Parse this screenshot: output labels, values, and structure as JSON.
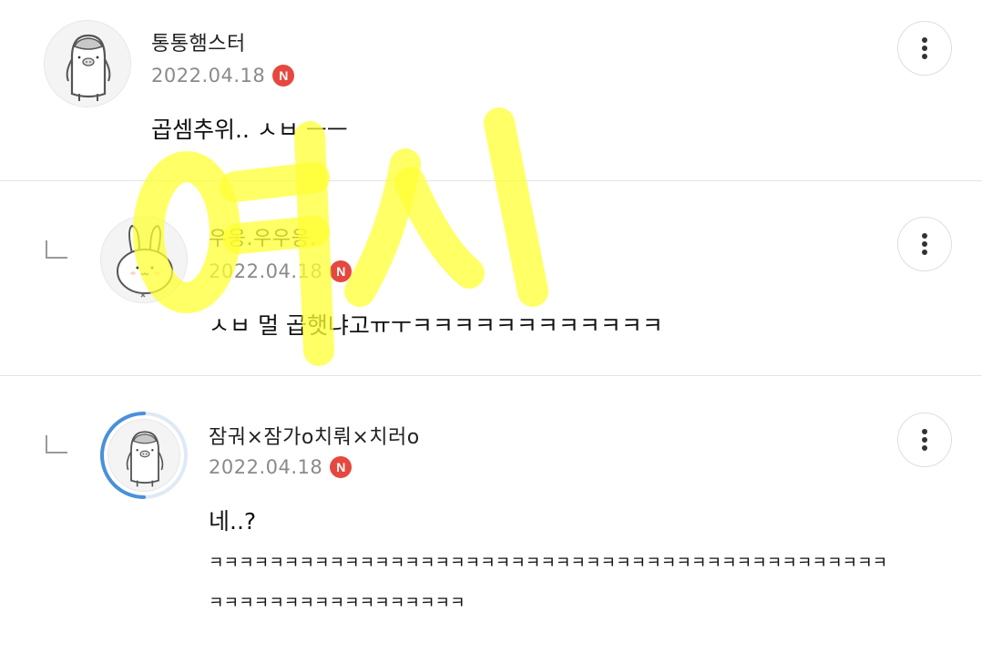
{
  "comments": [
    {
      "nickname": "통통햄스터",
      "date": "2022.04.18",
      "badge": "N",
      "text": "곱셈추위.. ㅅㅂ ㅡㅡ",
      "avatar_icon": "penguin-icon"
    },
    {
      "nickname": "우웅.우우웅.",
      "date": "2022.04.18",
      "badge": "N",
      "text": "ㅅㅂ 멀 곱햇냐고ㅠㅜㅋㅋㅋㅋㅋㅋㅋㅋㅋㅋㅋㅋ",
      "avatar_icon": "bunny-icon"
    },
    {
      "nickname": "잠궈×잠가o치뤄×치러o",
      "date": "2022.04.18",
      "badge": "N",
      "text_lines": [
        "네..?",
        "ㅋㅋㅋㅋㅋㅋㅋㅋㅋㅋㅋㅋㅋㅋㅋㅋㅋㅋㅋㅋㅋㅋㅋㅋㅋㅋㅋㅋㅋㅋㅋㅋㅋㅋㅋㅋㅋㅋㅋㅋㅋㅋㅋㅋㅋ",
        "ㅋㅋㅋㅋㅋㅋㅋㅋㅋㅋㅋㅋㅋㅋㅋㅋㅋ"
      ],
      "avatar_icon": "penguin-icon"
    }
  ],
  "watermark": "여시",
  "colors": {
    "badge": "#e5483f",
    "watermark": "#ffff00",
    "ring": "#4a90d9"
  }
}
